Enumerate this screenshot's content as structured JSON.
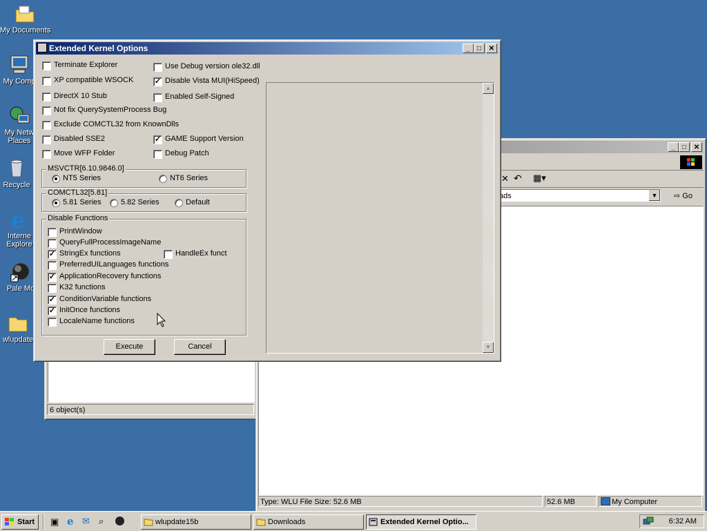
{
  "desktop": {
    "icons": [
      {
        "label": "My Documents"
      },
      {
        "label": "My Comp"
      },
      {
        "label": "My Netw\nPlaces"
      },
      {
        "label": "Recycle"
      },
      {
        "label": "Interne\nExplore"
      },
      {
        "label": "Pale Mo"
      },
      {
        "label": "wlupdate"
      }
    ]
  },
  "bg_window_left": {
    "status": "6 object(s)"
  },
  "bg_window_right": {
    "address_value": "ads",
    "go_label": "Go",
    "status_type": "Type: WLU File Size: 52.6 MB",
    "status_size": "52.6 MB",
    "status_zone": "My Computer"
  },
  "dialog": {
    "title": "Extended Kernel Options",
    "left_options": [
      {
        "label": "Terminate Explorer",
        "checked": false
      },
      {
        "label": "XP compatible WSOCK",
        "checked": false
      },
      {
        "label": "DirectX 10 Stub",
        "checked": false
      },
      {
        "label": "Not fix QuerySystemProcess Bug",
        "checked": false
      },
      {
        "label": "Exclude COMCTL32 from KnownDlls",
        "checked": false
      },
      {
        "label": "Disabled SSE2",
        "checked": false
      },
      {
        "label": "Move WFP Folder",
        "checked": false
      }
    ],
    "right_options": [
      {
        "label": "Use Debug version ole32.dll",
        "checked": false
      },
      {
        "label": "Disable Vista MUI(HiSpeed)",
        "checked": true
      },
      {
        "label": "Enabled Self-Signed",
        "checked": false
      },
      {
        "label": "GAME Support Version",
        "checked": true
      },
      {
        "label": "Debug Patch",
        "checked": false
      }
    ],
    "msvcrt": {
      "title": "MSVCTR[6.10.9846.0]",
      "options": [
        {
          "label": "NT5 Series",
          "selected": true
        },
        {
          "label": "NT6 Series",
          "selected": false
        }
      ]
    },
    "comctl": {
      "title": "COMCTL32[5.81]",
      "options": [
        {
          "label": "5.81 Series",
          "selected": true
        },
        {
          "label": "5.82 Series",
          "selected": false
        },
        {
          "label": "Default",
          "selected": false
        }
      ]
    },
    "disable_functions": {
      "title": "Disable Functions",
      "items": [
        {
          "label": "PrintWindow",
          "checked": false
        },
        {
          "label": "QueryFullProcessImageName",
          "checked": false
        },
        {
          "label": "StringEx functions",
          "checked": true
        },
        {
          "label": "PreferredUILanguages functions",
          "checked": false
        },
        {
          "label": "ApplicationRecovery functions",
          "checked": true
        },
        {
          "label": "K32 functions",
          "checked": false
        },
        {
          "label": "ConditionVariable functions",
          "checked": true
        },
        {
          "label": "InitOnce functions",
          "checked": true
        },
        {
          "label": "LocaleName functions",
          "checked": false
        }
      ],
      "extra": {
        "label": "HandleEx funct",
        "checked": false
      }
    },
    "execute_label": "Execute",
    "cancel_label": "Cancel"
  },
  "taskbar": {
    "start_label": "Start",
    "tasks": [
      {
        "label": "wlupdate15b",
        "active": false
      },
      {
        "label": "Downloads",
        "active": false
      },
      {
        "label": "Extended Kernel Optio...",
        "active": true
      }
    ],
    "clock": "6:32 AM"
  }
}
